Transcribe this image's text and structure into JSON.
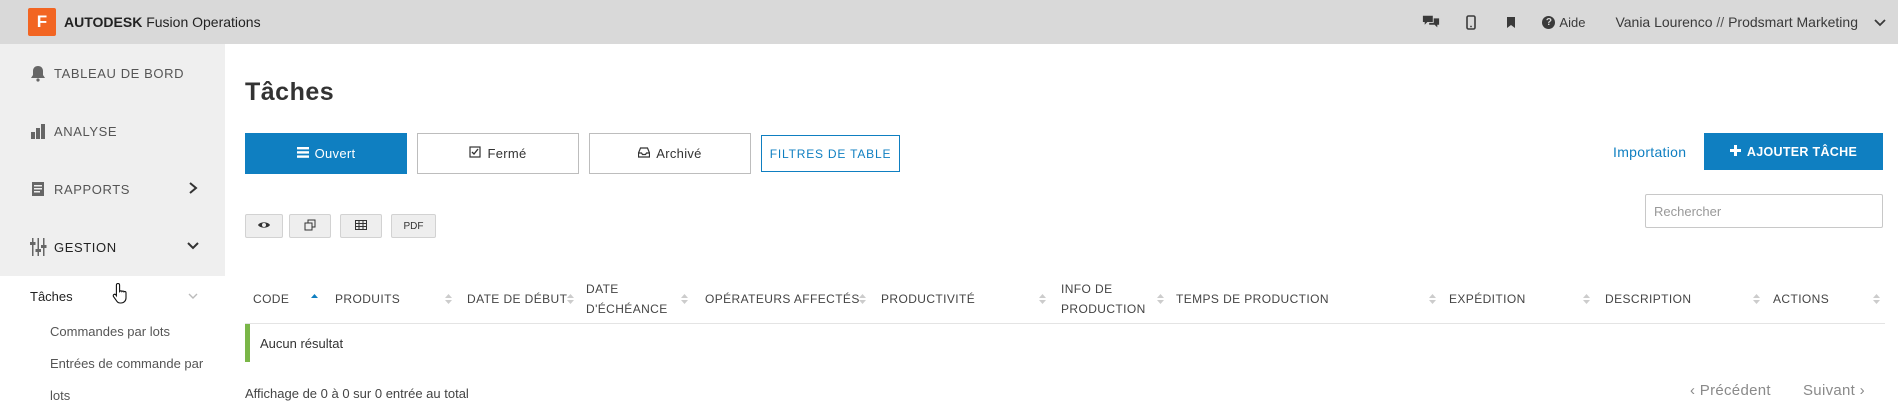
{
  "app": {
    "logo_letter": "F",
    "brand_bold": "AUTODESK",
    "brand_rest": "Fusion Operations",
    "accent": "#f26522"
  },
  "topbar": {
    "icons": [
      "chat-icon",
      "mobile-icon",
      "bookmark-icon"
    ],
    "help_label": "Aide",
    "user_name": "Vania Lourenco",
    "separator": "//",
    "company": "Prodsmart Marketing"
  },
  "sidebar": {
    "items": [
      {
        "label": "TABLEAU DE BORD",
        "icon": "bell-icon"
      },
      {
        "label": "ANALYSE",
        "icon": "bar-chart-icon"
      },
      {
        "label": "RAPPORTS",
        "icon": "report-icon"
      },
      {
        "label": "GESTION",
        "icon": "sliders-icon"
      }
    ],
    "active_sub": "Tâches",
    "sub_items": [
      "Commandes par lots",
      "Entrées de commande par",
      "lots"
    ]
  },
  "main": {
    "title": "Tâches",
    "tabs": {
      "open": "Ouvert",
      "closed": "Fermé",
      "archived": "Archivé",
      "filters": "FILTRES DE TABLE"
    },
    "import_label": "Importation",
    "add_label": "AJOUTER TÂCHE",
    "search_placeholder": "Rechercher",
    "tools": {
      "pdf": "PDF"
    },
    "columns": {
      "code": "CODE",
      "products": "PRODUITS",
      "start": "DATE DE DÉBUT",
      "due_1": "DATE",
      "due_2": "D'ÉCHÉANCE",
      "operators": "OPÉRATEURS AFFECTÉS",
      "productivity": "PRODUCTIVITÉ",
      "info_1": "INFO DE",
      "info_2": "PRODUCTION",
      "time": "TEMPS DE PRODUCTION",
      "shipping": "EXPÉDITION",
      "description": "DESCRIPTION",
      "actions": "ACTIONS"
    },
    "empty": "Aucun résultat",
    "footer_info": "Affichage de 0 à 0 sur 0 entrée au total",
    "prev": "Précédent",
    "next": "Suivant"
  },
  "colors": {
    "primary": "#0f7fc1",
    "success_bar": "#7ab648",
    "topbar_bg": "#d9d9d9",
    "sidebar_bg": "#efefef"
  }
}
